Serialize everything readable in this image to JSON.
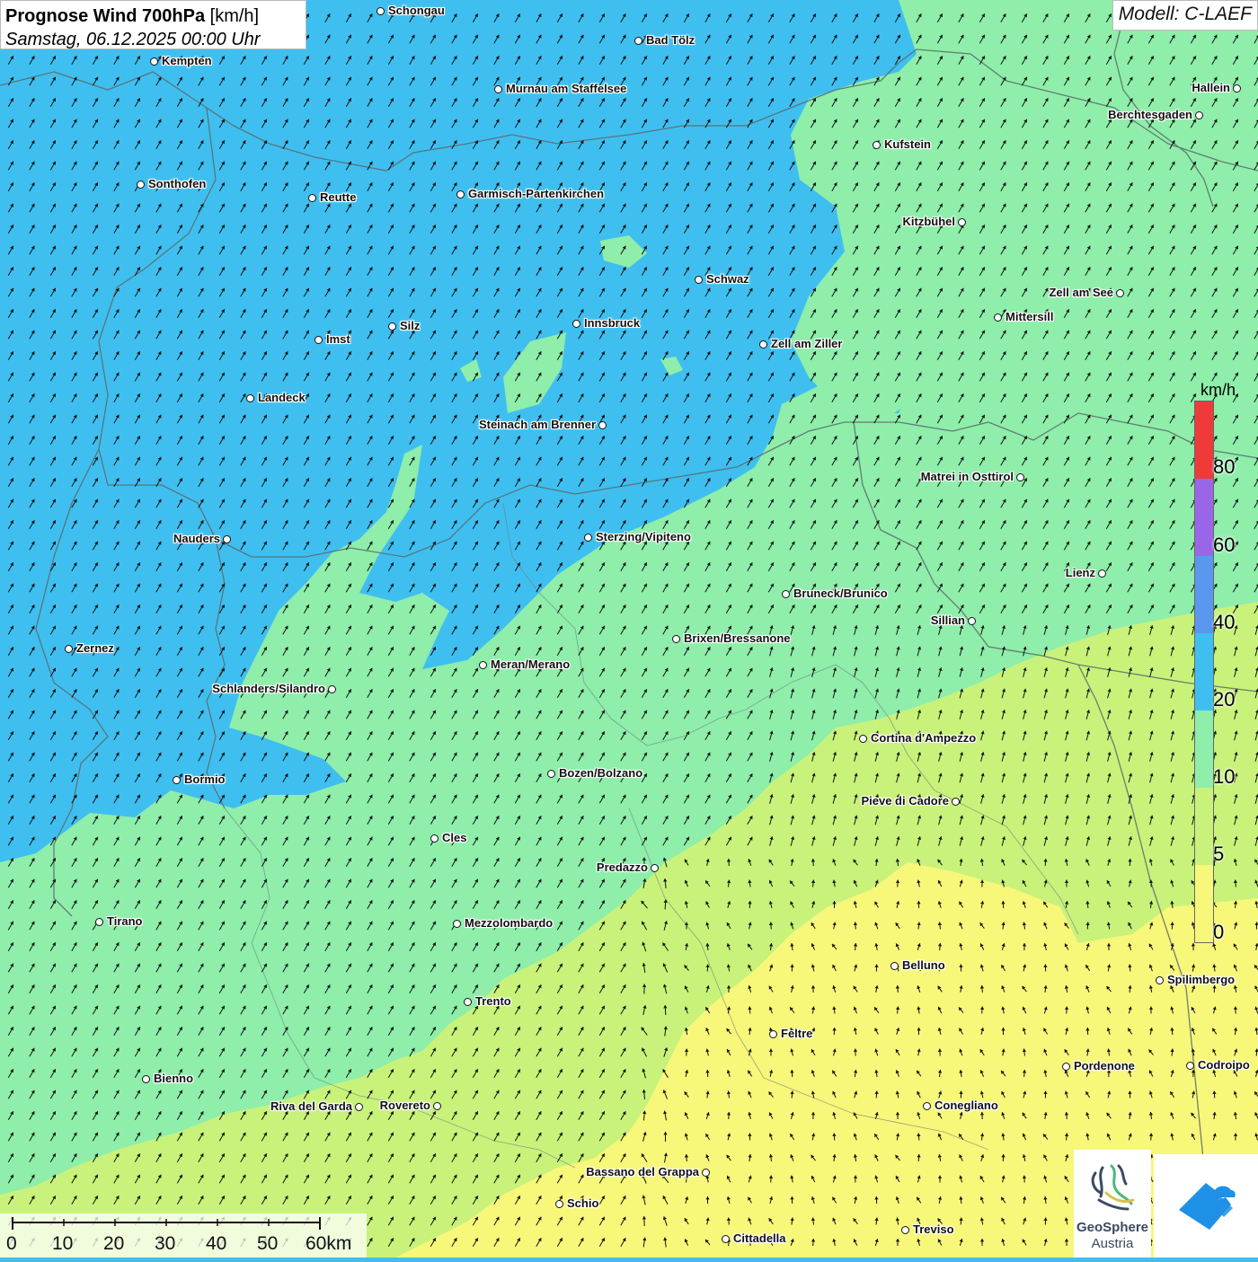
{
  "header": {
    "title_bold": "Prognose Wind 700hPa",
    "title_unit": " [km/h]",
    "subtitle": "Samstag, 06.12.2025 00:00 Uhr",
    "model": "Modell: C-LAEF"
  },
  "colors": {
    "band_0_5": "#f7f77a",
    "band_5_10": "#c8f27a",
    "band_10_20": "#8eeeaa",
    "band_20_40": "#3fbff0",
    "band_40_60": "#5a98ef",
    "band_60_80": "#9a66e8",
    "band_80_plus": "#f03a3a"
  },
  "legend": {
    "unit": "km/h",
    "labels": [
      "80",
      "60",
      "40",
      "20",
      "10",
      "5",
      "0"
    ]
  },
  "scale_bar": {
    "labels": [
      "0",
      "10",
      "20",
      "30",
      "40",
      "50",
      "60km"
    ]
  },
  "logos": {
    "geosphere_line1": "GeoSphere",
    "geosphere_line2": "Austria"
  },
  "cities": [
    {
      "name": "Schongau"
    },
    {
      "name": "Bad Tölz"
    },
    {
      "name": "Kempten"
    },
    {
      "name": "Murnau am Staffelsee"
    },
    {
      "name": "Hallein"
    },
    {
      "name": "Berchtesgaden"
    },
    {
      "name": "Kufstein"
    },
    {
      "name": "Sonthofen"
    },
    {
      "name": "Reutte"
    },
    {
      "name": "Garmisch-Partenkirchen"
    },
    {
      "name": "Kitzbühel"
    },
    {
      "name": "Schwaz"
    },
    {
      "name": "Zell am See"
    },
    {
      "name": "Mittersill"
    },
    {
      "name": "Innsbruck"
    },
    {
      "name": "Silz"
    },
    {
      "name": "Imst"
    },
    {
      "name": "Zell am Ziller"
    },
    {
      "name": "Landeck"
    },
    {
      "name": "Steinach am Brenner"
    },
    {
      "name": "Matrei in Osttirol"
    },
    {
      "name": "Nauders"
    },
    {
      "name": "Sterzing/Vipiteno"
    },
    {
      "name": "Lienz"
    },
    {
      "name": "Bruneck/Brunico"
    },
    {
      "name": "Sillian"
    },
    {
      "name": "Zernez"
    },
    {
      "name": "Brixen/Bressanone"
    },
    {
      "name": "Meran/Merano"
    },
    {
      "name": "Schlanders/Silandro"
    },
    {
      "name": "Cortina d'Ampezzo"
    },
    {
      "name": "Bormio"
    },
    {
      "name": "Bozen/Bolzano"
    },
    {
      "name": "Pieve di Cadore"
    },
    {
      "name": "Cles"
    },
    {
      "name": "Predazzo"
    },
    {
      "name": "Tirano"
    },
    {
      "name": "Mezzolombardo"
    },
    {
      "name": "Belluno"
    },
    {
      "name": "Spilimbergo"
    },
    {
      "name": "Trento"
    },
    {
      "name": "Feltre"
    },
    {
      "name": "Bienno"
    },
    {
      "name": "Pordenone"
    },
    {
      "name": "Codroipo"
    },
    {
      "name": "Riva del Garda"
    },
    {
      "name": "Rovereto"
    },
    {
      "name": "Conegliano"
    },
    {
      "name": "Bassano del Grappa"
    },
    {
      "name": "Schio"
    },
    {
      "name": "Treviso"
    },
    {
      "name": "Cittadella"
    }
  ]
}
